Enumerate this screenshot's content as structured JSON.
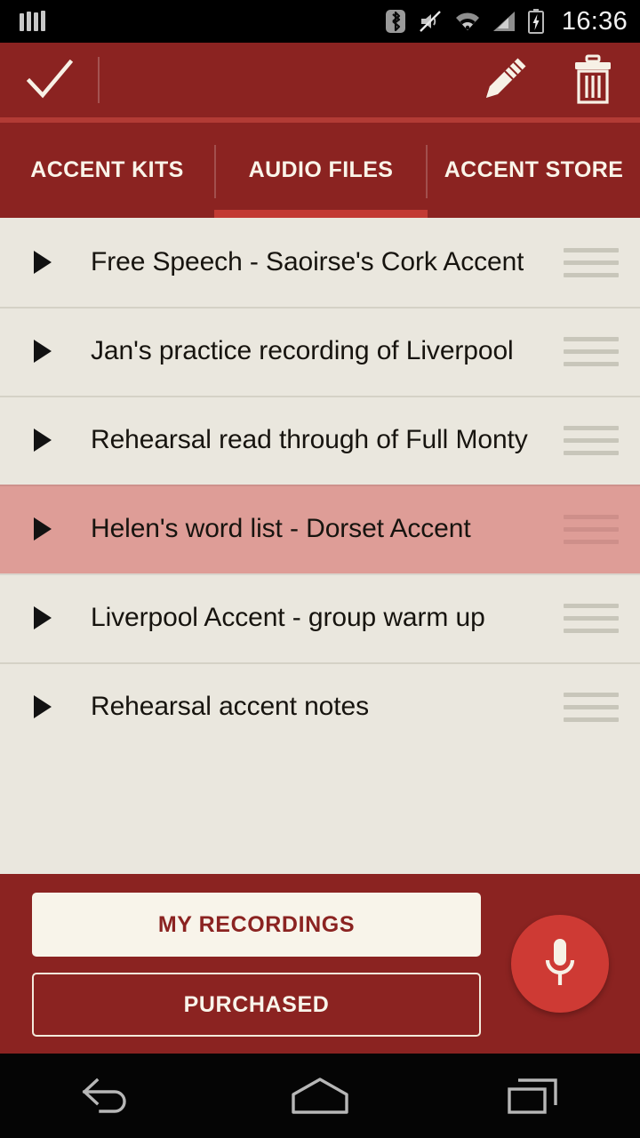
{
  "status_bar": {
    "left_icon": "equalizer-icon",
    "icons": [
      "bluetooth-icon",
      "mute-icon",
      "wifi-icon",
      "cellular-signal-icon",
      "battery-charging-icon"
    ],
    "time": "16:36"
  },
  "action_bar": {
    "confirm_icon": "check-icon",
    "edit_icon": "pencil-icon",
    "delete_icon": "trash-icon"
  },
  "tabs": {
    "active_index": 1,
    "items": [
      {
        "label": "ACCENT KITS"
      },
      {
        "label": "AUDIO FILES"
      },
      {
        "label": "ACCENT STORE"
      }
    ]
  },
  "list": {
    "rows": [
      {
        "title": "Free Speech - Saoirse's Cork Accent",
        "selected": false
      },
      {
        "title": "Jan's practice recording of Liverpool",
        "selected": false
      },
      {
        "title": "Rehearsal read through of Full Monty",
        "selected": false
      },
      {
        "title": "Helen's word list - Dorset Accent",
        "selected": true
      },
      {
        "title": "Liverpool Accent - group warm up",
        "selected": false
      },
      {
        "title": "Rehearsal accent notes",
        "selected": false
      }
    ],
    "play_icon": "play-icon",
    "drag_icon": "drag-handle-icon"
  },
  "bottom_bar": {
    "my_recordings_label": "MY RECORDINGS",
    "purchased_label": "PURCHASED",
    "record_fab_icon": "microphone-icon"
  },
  "nav_bar": {
    "back_icon": "back-icon",
    "home_icon": "home-icon",
    "recents_icon": "recents-icon"
  },
  "colors": {
    "primary_dark_red": "#8B2321",
    "accent_red": "#C23A33",
    "fab_red": "#CE3A34",
    "cream": "#EAE7DE",
    "button_cream": "#F8F4EA",
    "selected_row": "#DE9D97",
    "divider": "#D5D2C6"
  }
}
